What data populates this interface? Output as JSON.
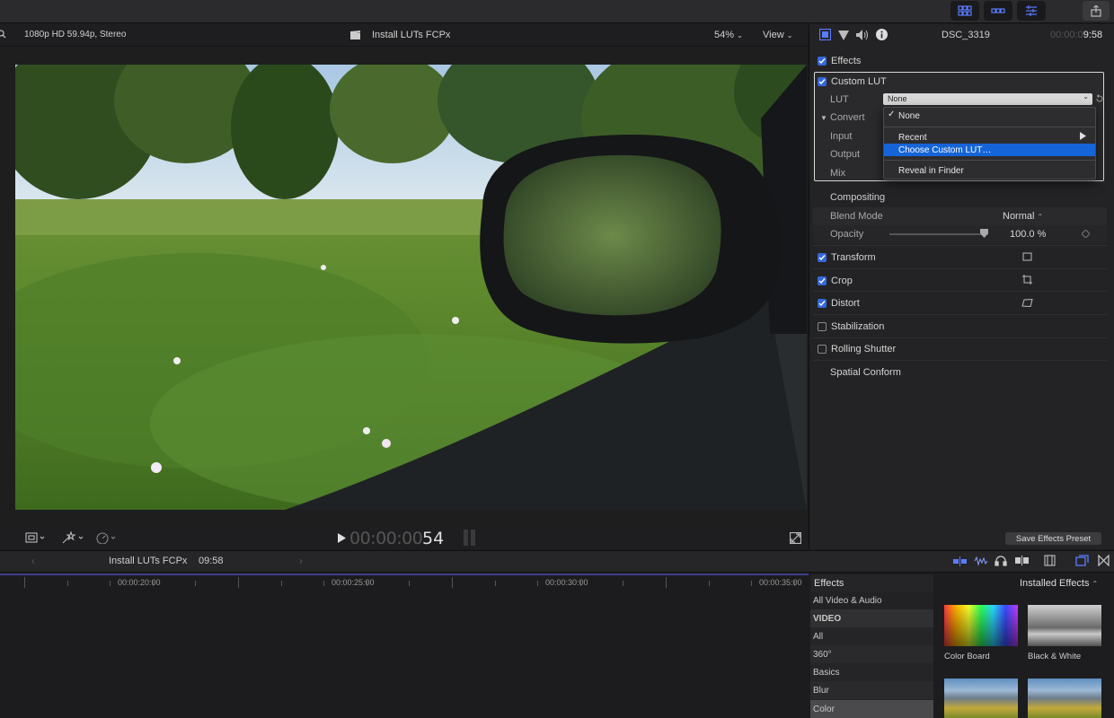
{
  "viewer": {
    "format": "1080p HD 59.94p, Stereo",
    "project": "Install LUTs FCPx",
    "zoom": "54%",
    "view_label": "View",
    "timecode_dim": "00:00:00",
    "timecode_bright": "54"
  },
  "inspector": {
    "clip_name": "DSC_3319",
    "duration_dim": "00:00:0",
    "duration_bright": "9:58",
    "effects_label": "Effects",
    "custom_lut": "Custom LUT",
    "lut_label": "LUT",
    "lut_value": "None",
    "convert_label": "Convert",
    "input_label": "Input",
    "output_label": "Output",
    "mix_label": "Mix",
    "compositing": "Compositing",
    "blend_mode_label": "Blend Mode",
    "blend_mode_value": "Normal",
    "opacity_label": "Opacity",
    "opacity_value": "100.0",
    "opacity_unit": "%",
    "opacity_level": 0.92,
    "transform": "Transform",
    "crop": "Crop",
    "distort": "Distort",
    "stabilization": "Stabilization",
    "rolling_shutter": "Rolling Shutter",
    "spatial_conform": "Spatial Conform",
    "save_preset": "Save Effects Preset"
  },
  "lut_menu": {
    "none": "None",
    "recent": "Recent",
    "choose": "Choose Custom LUT…",
    "reveal": "Reveal in Finder"
  },
  "timeline": {
    "project": "Install LUTs FCPx",
    "duration": "09:58",
    "ticks": [
      "00:00:20:00",
      "00:00:25:00",
      "00:00:30:00",
      "00:00:35:00"
    ]
  },
  "effects_browser": {
    "title": "Effects",
    "filter": "Installed Effects",
    "categories": [
      "All Video & Audio",
      "VIDEO",
      "All",
      "360°",
      "Basics",
      "Blur",
      "Color"
    ],
    "items": [
      "Color Board",
      "Black & White"
    ]
  }
}
